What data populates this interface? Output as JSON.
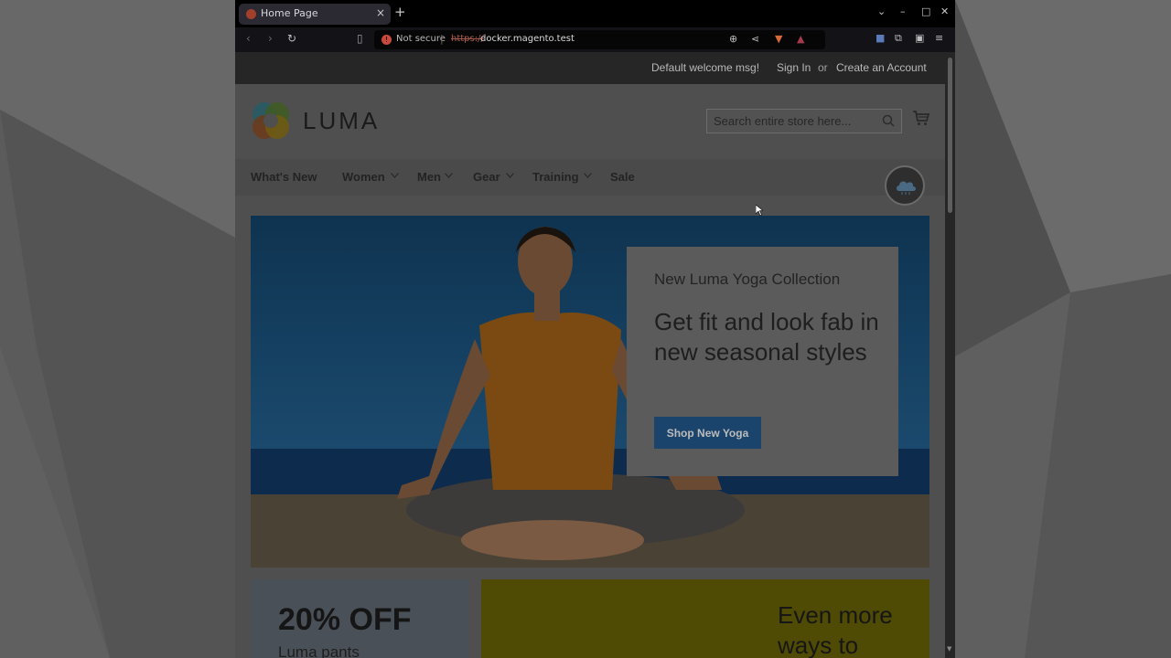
{
  "browser": {
    "tab_title": "Home Page",
    "security_label": "Not secure",
    "url_scheme": "https://",
    "url_host": "docker.magento.test"
  },
  "store": {
    "welcome_message": "Default welcome msg!",
    "sign_in": "Sign In",
    "or": "or",
    "create_account": "Create an Account",
    "logo_text": "LUMA",
    "search_placeholder": "Search entire store here..."
  },
  "nav": {
    "items": [
      {
        "label": "What's New",
        "has_dropdown": false
      },
      {
        "label": "Women",
        "has_dropdown": true
      },
      {
        "label": "Men",
        "has_dropdown": true
      },
      {
        "label": "Gear",
        "has_dropdown": true
      },
      {
        "label": "Training",
        "has_dropdown": true
      },
      {
        "label": "Sale",
        "has_dropdown": false
      }
    ]
  },
  "hero": {
    "kicker": "New Luma Yoga Collection",
    "headline": "Get fit and look fab in new seasonal styles",
    "button_label": "Shop New Yoga"
  },
  "tiles": {
    "left_title": "20% OFF",
    "left_subtitle": "Luma pants",
    "right_title": "Even more ways to"
  },
  "colors": {
    "accent_button": "#1979c3",
    "promo_yellow": "#ffdd00"
  }
}
